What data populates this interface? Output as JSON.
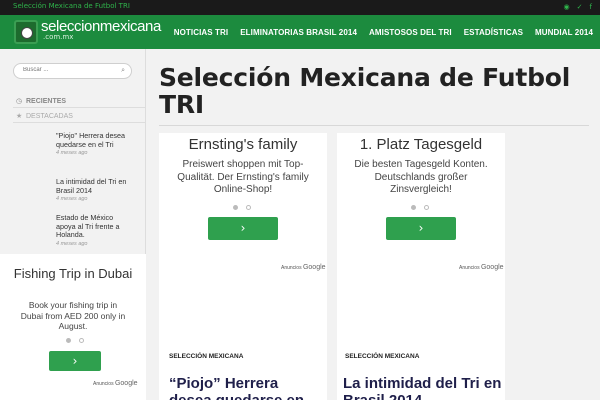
{
  "topbar": {
    "tagline": "Selección Mexicana de Futbol TRI",
    "social": [
      {
        "icon": "rss-icon",
        "glyph": "◉"
      },
      {
        "icon": "twitter-icon",
        "glyph": "✓"
      },
      {
        "icon": "facebook-icon",
        "glyph": "f"
      }
    ]
  },
  "header": {
    "logo_name": "seleccionmexicana",
    "logo_tld": ".com.mx",
    "nav": [
      "NOTICIAS TRI",
      "ELIMINATORIAS BRASIL 2014",
      "AMISTOSOS DEL TRI",
      "ESTADÍSTICAS",
      "MUNDIAL 2014"
    ]
  },
  "sidebar": {
    "search_placeholder": "Buscar ...",
    "search_icon": "search-icon",
    "recientes_label": "RECIENTES",
    "destacadas_label": "DESTACADAS",
    "posts": [
      {
        "title": "\"Piojo\" Herrera desea quedarse en el Tri",
        "date": "4 meses ago"
      },
      {
        "title": "La intimidad del Tri en Brasil 2014",
        "date": "4 meses ago"
      },
      {
        "title": "Estado de México apoya al Tri frente a Holanda.",
        "date": "4 meses ago"
      }
    ],
    "ad": {
      "title": "Fishing Trip in Dubai",
      "text": "Book your fishing trip in Dubai from AED 200 only in August.",
      "arrow": "›",
      "ads_by": "Anuncios",
      "ads_brand": "Google"
    }
  },
  "main": {
    "title": "Selección Mexicana de Futbol TRI",
    "ads": [
      {
        "title": "Ernsting's family",
        "text": "Preiswert shoppen mit Top-Qualität. Der Ernsting's family Online-Shop!",
        "arrow": "›",
        "ads_by": "Anuncios",
        "ads_brand": "Google"
      },
      {
        "title": "1. Platz Tagesgeld",
        "text": "Die besten Tagesgeld Konten. Deutschlands großer Zinsvergleich!",
        "arrow": "›",
        "ads_by": "Anuncios",
        "ads_brand": "Google"
      }
    ],
    "cards": [
      {
        "category": "SELECCIÓN MEXICANA",
        "headline": "“Piojo” Herrera desea quedarse en"
      },
      {
        "category": "SELECCIÓN MEXICANA",
        "headline": "La intimidad del Tri en Brasil 2014"
      }
    ]
  },
  "colors": {
    "accent": "#1c8b3e",
    "button": "#2fa04e",
    "topbar": "#1a1a1a"
  }
}
